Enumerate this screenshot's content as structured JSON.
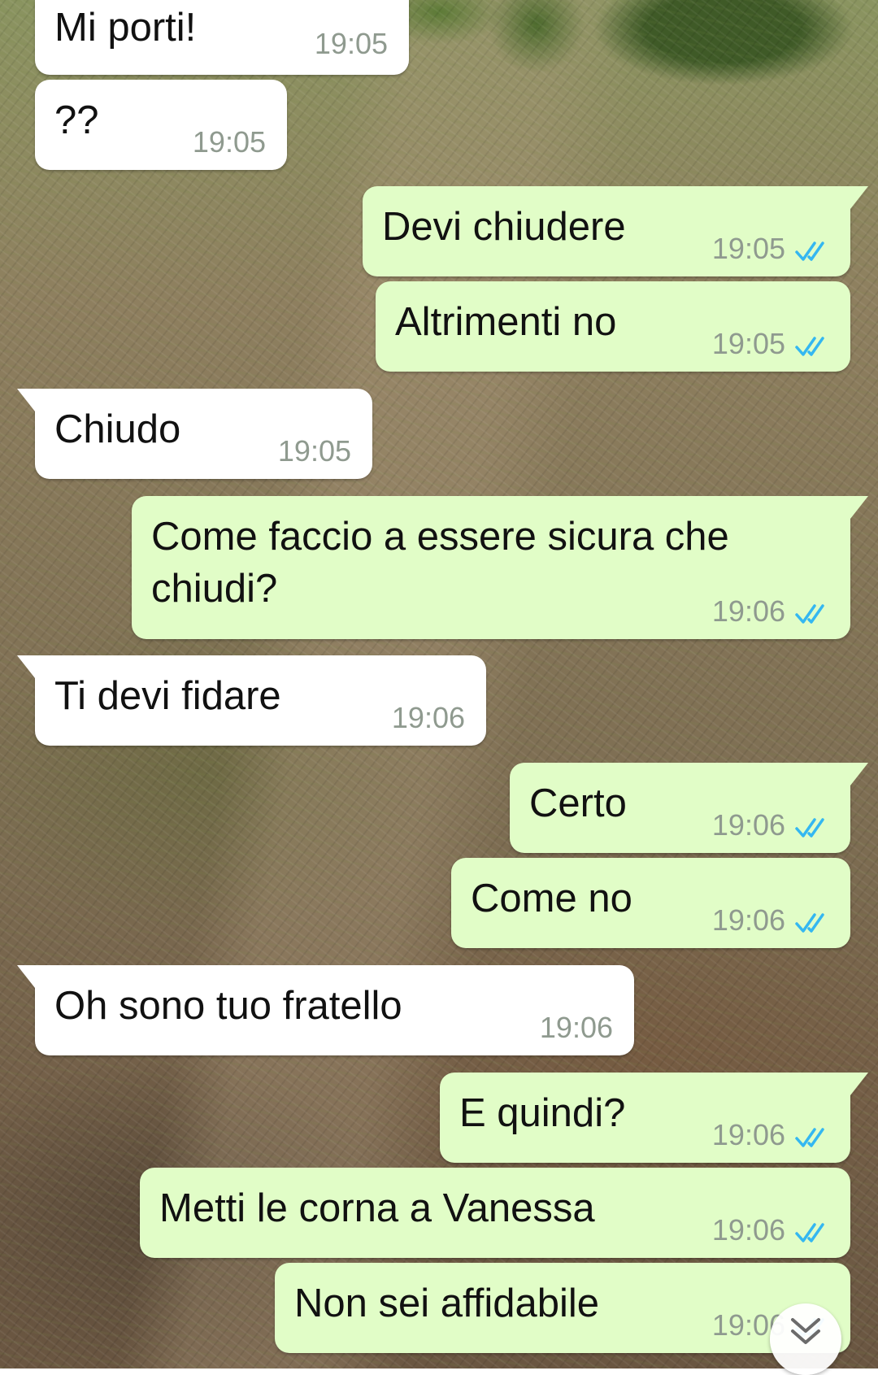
{
  "colors": {
    "incoming_bubble": "#ffffff",
    "outgoing_bubble": "#e1fdc7",
    "read_ticks": "#34b7f1",
    "timestamp": "#8f9a8f"
  },
  "messages": [
    {
      "direction": "incoming",
      "text": "Mi porti!",
      "time": "19:05"
    },
    {
      "direction": "incoming",
      "text": "??",
      "time": "19:05"
    },
    {
      "direction": "outgoing",
      "text": "Devi chiudere",
      "time": "19:05",
      "status": "read-double-check-icon"
    },
    {
      "direction": "outgoing",
      "text": "Altrimenti no",
      "time": "19:05",
      "status": "read-double-check-icon"
    },
    {
      "direction": "incoming",
      "text": "Chiudo",
      "time": "19:05"
    },
    {
      "direction": "outgoing",
      "text": "Come faccio a essere sicura che chiudi?",
      "time": "19:06",
      "status": "read-double-check-icon"
    },
    {
      "direction": "incoming",
      "text": "Ti devi fidare",
      "time": "19:06"
    },
    {
      "direction": "outgoing",
      "text": "Certo",
      "time": "19:06",
      "status": "read-double-check-icon"
    },
    {
      "direction": "outgoing",
      "text": "Come no",
      "time": "19:06",
      "status": "read-double-check-icon"
    },
    {
      "direction": "incoming",
      "text": "Oh sono tuo fratello",
      "time": "19:06"
    },
    {
      "direction": "outgoing",
      "text": "E quindi?",
      "time": "19:06",
      "status": "read-double-check-icon"
    },
    {
      "direction": "outgoing",
      "text": "Metti le corna a Vanessa",
      "time": "19:06",
      "status": "read-double-check-icon"
    },
    {
      "direction": "outgoing",
      "text": "Non sei affidabile",
      "time": "19:06",
      "status": "read-double-check-icon"
    }
  ],
  "scroll_to_bottom": {
    "icon": "double-chevron-down-icon"
  }
}
